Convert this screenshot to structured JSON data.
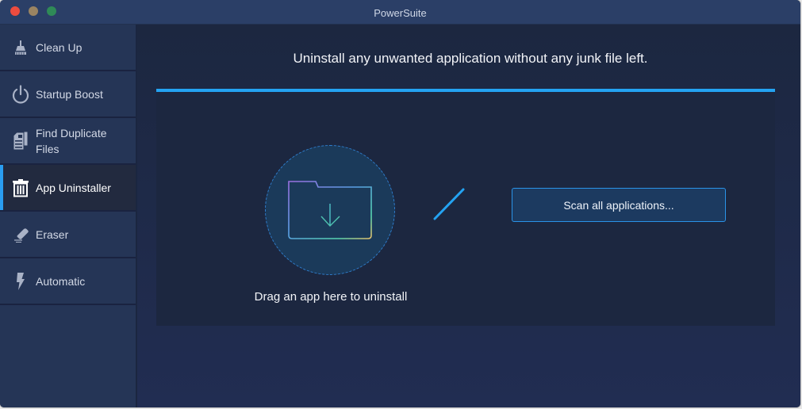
{
  "window": {
    "title": "PowerSuite",
    "controls": [
      "close",
      "minimize",
      "maximize"
    ]
  },
  "sidebar": {
    "items": [
      {
        "label": "Clean Up",
        "icon": "broom-icon",
        "active": false
      },
      {
        "label": "Startup Boost",
        "icon": "power-icon",
        "active": false
      },
      {
        "label": "Find Duplicate Files",
        "icon": "duplicate-files-icon",
        "active": false
      },
      {
        "label": "App Uninstaller",
        "icon": "trash-icon",
        "active": true
      },
      {
        "label": "Eraser",
        "icon": "eraser-icon",
        "active": false
      },
      {
        "label": "Automatic",
        "icon": "lightning-icon",
        "active": false
      }
    ]
  },
  "main": {
    "headline": "Uninstall any unwanted application without any junk file left.",
    "drop_zone": {
      "icon": "folder-download-icon",
      "label": "Drag an app here to uninstall"
    },
    "scan_button": "Scan all applications..."
  },
  "colors": {
    "accent": "#24a3f2",
    "sidebar_bg": "#253556",
    "active_item_bg": "#222a3f",
    "titlebar_bg": "#2b3f67"
  }
}
